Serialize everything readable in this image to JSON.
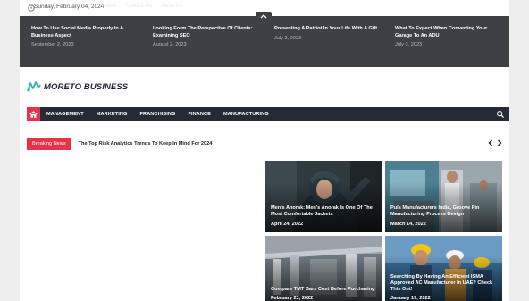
{
  "topbar": {
    "date": "Sunday, February 04, 2024",
    "links": [
      "Home",
      "Contact Us",
      "About Us"
    ]
  },
  "ticker": [
    {
      "title": "How To Use Social Media Properly In A Business Aspect",
      "date": "September 2, 2023"
    },
    {
      "title": "Looking Form The Perspective Of Clients: Examining SEO",
      "date": "August 2, 2023"
    },
    {
      "title": "Presenting A Patriot In Your Life With A Gift",
      "date": "July 3, 2023"
    },
    {
      "title": "What To Expect When Converting Your Garage To An ADU",
      "date": "July 3, 2023"
    }
  ],
  "brand": {
    "name": "MORETO BUSINESS"
  },
  "nav": {
    "items": [
      "MANAGEMENT",
      "MARKETING",
      "FRANCHISING",
      "FINANCE",
      "MANUFACTURING"
    ]
  },
  "breaking": {
    "label": "Breaking News",
    "headline": "The Top Risk Analytics Trends To Keep In Mind For 2024"
  },
  "cards": [
    {
      "title": "Men's Anorak: Men's Anorak Is One Of The Most Comfortable Jackets",
      "date": "April 24, 2022"
    },
    {
      "title": "Puls Manufacturers India, Groove Pin Manufacturing Process Design",
      "date": "March 14, 2022"
    },
    {
      "title": "Compare TMT Bars Cost Before Purchasing",
      "date": "February 21, 2022"
    },
    {
      "title": "Searching By Having An Efficient ISMA Approved AC Manufacturer In UAE? Check This Out!",
      "date": "January 19, 2022"
    }
  ],
  "colors": {
    "accent": "#e6334a",
    "nav": "#262a36",
    "ticker": "#3e4045"
  },
  "icons": {
    "topbar": "clock-icon",
    "nav_home": "home-icon",
    "nav_search": "search-icon",
    "ticker_toggle": "chevron-up-icon"
  }
}
